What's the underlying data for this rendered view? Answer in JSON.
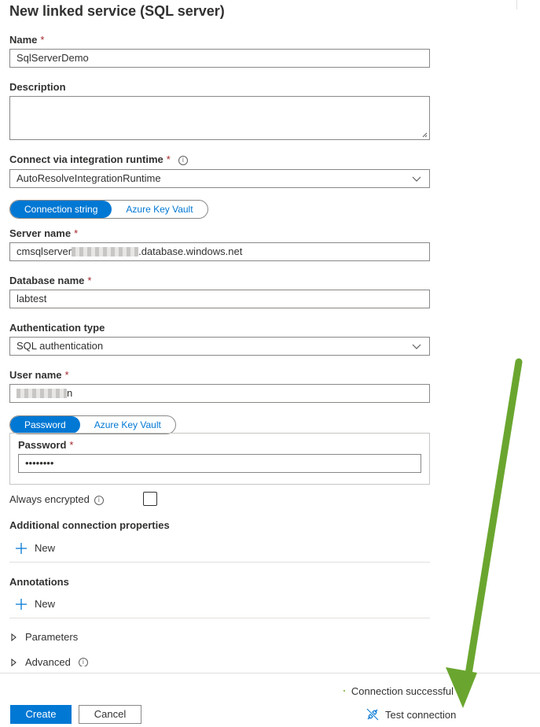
{
  "panel": {
    "title": "New linked service (SQL server)"
  },
  "form": {
    "name": {
      "label": "Name",
      "required": "*",
      "value": "SqlServerDemo"
    },
    "description": {
      "label": "Description",
      "value": ""
    },
    "runtime": {
      "label": "Connect via integration runtime",
      "required": "*",
      "value": "AutoResolveIntegrationRuntime"
    },
    "connection_toggle": {
      "options": [
        "Connection string",
        "Azure Key Vault"
      ],
      "selected": "Connection string"
    },
    "server": {
      "label": "Server name",
      "required": "*",
      "value_prefix": "cmsqlserver",
      "value_suffix": ".database.windows.net"
    },
    "database": {
      "label": "Database name",
      "required": "*",
      "value": "labtest"
    },
    "auth_type": {
      "label": "Authentication type",
      "value": "SQL authentication"
    },
    "username": {
      "label": "User name",
      "required": "*",
      "value_tail": "n"
    },
    "password_toggle": {
      "options": [
        "Password",
        "Azure Key Vault"
      ],
      "selected": "Password"
    },
    "password": {
      "label": "Password",
      "required": "*",
      "value": "••••••••"
    },
    "always_encrypted": {
      "label": "Always encrypted",
      "checked": false
    },
    "additional_props": {
      "label": "Additional connection properties",
      "new_label": "New"
    },
    "annotations": {
      "label": "Annotations",
      "new_label": "New"
    },
    "parameters": {
      "label": "Parameters"
    },
    "advanced": {
      "label": "Advanced"
    }
  },
  "footer": {
    "create_label": "Create",
    "cancel_label": "Cancel",
    "status_text": "Connection successful",
    "test_label": "Test connection"
  },
  "icons": {
    "info": "info-icon",
    "chevron": "chevron-down-icon",
    "plus": "plus-icon",
    "caret": "caret-right-icon",
    "success": "check-circle-icon",
    "plug": "plug-icon",
    "annotation_arrow": "green-arrow"
  },
  "colors": {
    "accent": "#0078d4",
    "required": "#a4262c",
    "success": "#57a300",
    "arrow": "#6aa62f"
  }
}
